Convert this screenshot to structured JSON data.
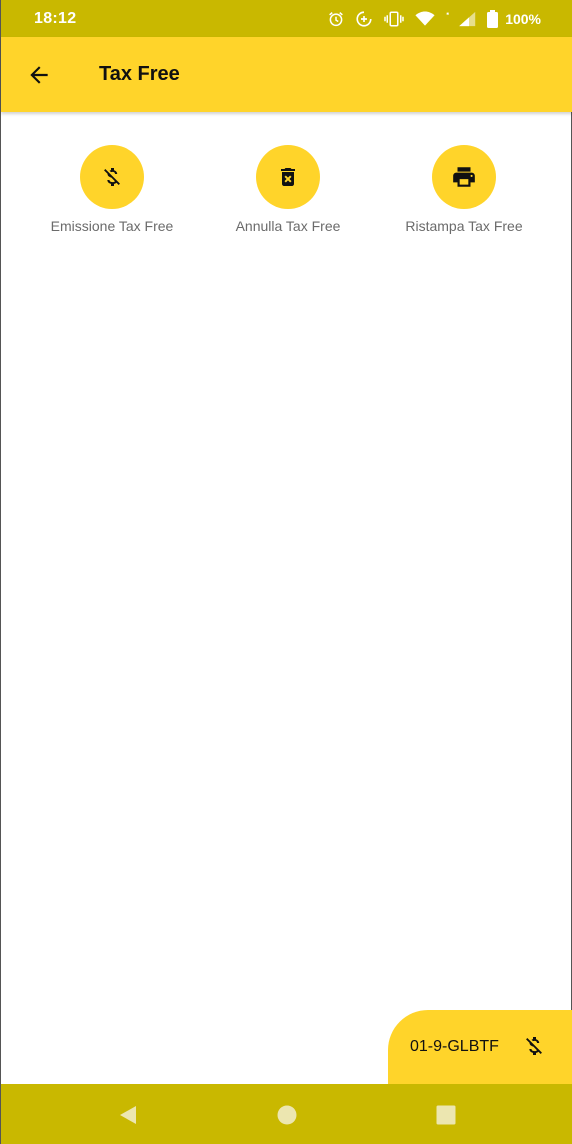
{
  "status_bar": {
    "time": "18:12",
    "battery": "100%",
    "icons": [
      "alarm-icon",
      "data-saver-icon",
      "vibrate-icon",
      "wifi-icon",
      "signal-icon",
      "battery-icon"
    ]
  },
  "app_bar": {
    "title": "Tax Free",
    "back_icon": "arrow-back-icon"
  },
  "actions": [
    {
      "label": "Emissione Tax Free",
      "icon": "money-off-icon"
    },
    {
      "label": "Annulla Tax Free",
      "icon": "delete-forever-icon"
    },
    {
      "label": "Ristampa Tax Free",
      "icon": "print-icon"
    }
  ],
  "terminal_tab": {
    "code": "01-9-GLBTF",
    "icon": "money-off-icon"
  },
  "nav_bar": {
    "buttons": [
      "back-triangle-icon",
      "home-circle-icon",
      "recents-square-icon"
    ]
  },
  "colors": {
    "accent": "#ffd42a",
    "system_bar": "#c9b800",
    "label_text": "#6b6b6b"
  }
}
